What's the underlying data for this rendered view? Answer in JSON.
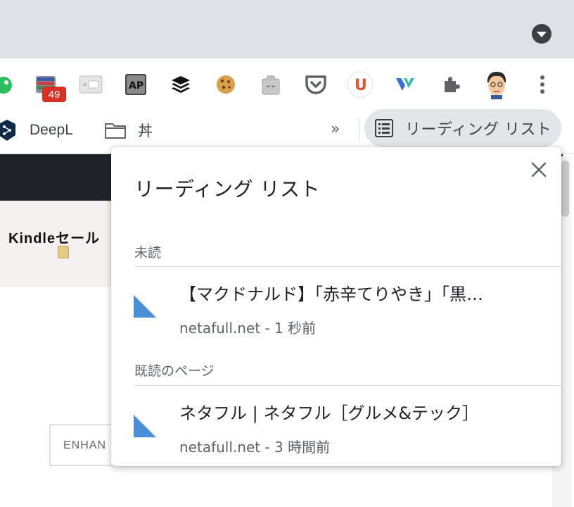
{
  "extensions": {
    "badge": "49",
    "names": [
      "evernote-icon",
      "mail-icon",
      "tab-icon",
      "ap-icon",
      "buffer-icon",
      "cookie-icon",
      "sleeping-tab-icon",
      "pocket-icon",
      "u-extension-icon",
      "v-extension-icon",
      "puzzle-icon",
      "profile-avatar",
      "more-menu-icon"
    ]
  },
  "bookmarks": {
    "deepl_label": "DeepL",
    "folder_label": "丼",
    "overflow": "»",
    "reading_list_label": "リーディング リスト"
  },
  "page": {
    "kindle_text": "Kindleセール",
    "enhance_text": "ENHAN"
  },
  "popup": {
    "title": "リーディング リスト",
    "unread_header": "未読",
    "read_header": "既読のページ",
    "unread_items": [
      {
        "title": "【マクドナルド】「赤辛てりやき」「黒…",
        "meta": "netafull.net - 1 秒前"
      }
    ],
    "read_items": [
      {
        "title": "ネタフル | ネタフル［グルメ&テック］",
        "meta": "netafull.net - 3 時間前"
      }
    ]
  },
  "colors": {
    "accent_blue": "#4a90d9",
    "badge_red": "#d93025"
  }
}
